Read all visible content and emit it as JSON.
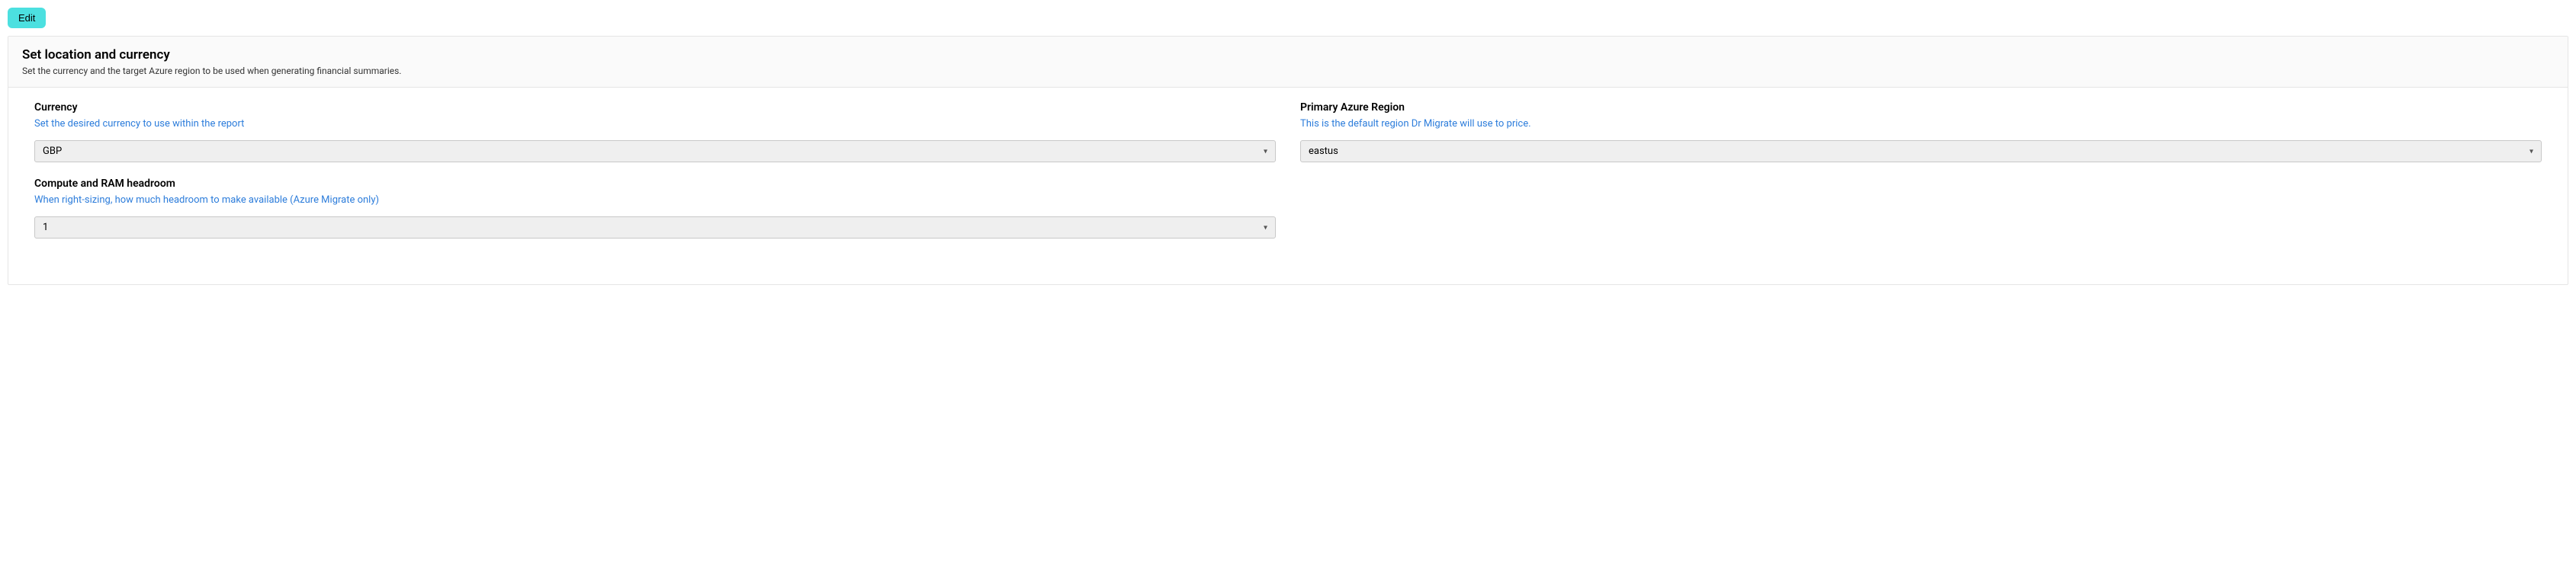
{
  "edit_button": "Edit",
  "header": {
    "title": "Set location and currency",
    "subtitle": "Set the currency and the target Azure region to be used when generating financial summaries."
  },
  "fields": {
    "currency": {
      "label": "Currency",
      "hint": "Set the desired currency to use within the report",
      "value": "GBP"
    },
    "region": {
      "label": "Primary Azure Region",
      "hint": "This is the default region Dr Migrate will use to price.",
      "value": "eastus"
    },
    "headroom": {
      "label": "Compute and RAM headroom",
      "hint": "When right-sizing, how much headroom to make available (Azure Migrate only)",
      "value": "1"
    }
  }
}
